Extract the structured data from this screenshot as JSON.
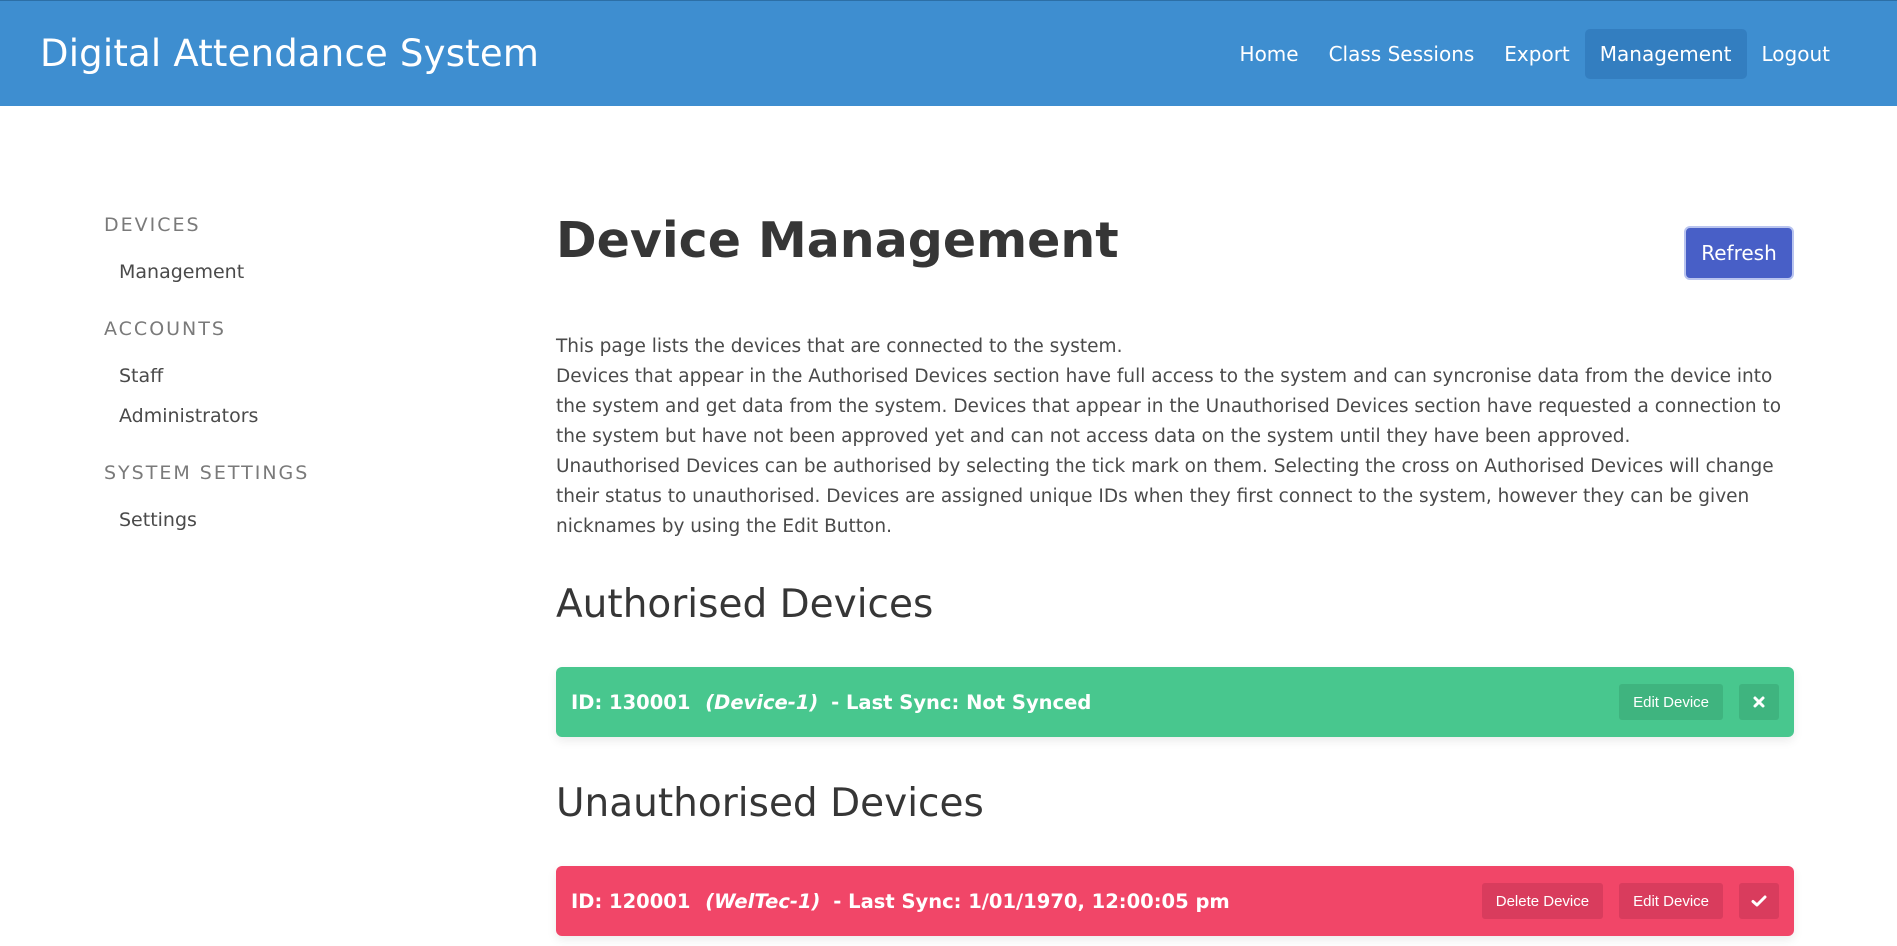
{
  "app": {
    "title": "Digital Attendance System"
  },
  "nav": {
    "items": [
      {
        "label": "Home"
      },
      {
        "label": "Class Sessions"
      },
      {
        "label": "Export"
      },
      {
        "label": "Management",
        "active": true
      },
      {
        "label": "Logout"
      }
    ]
  },
  "sidebar": {
    "sections": [
      {
        "label": "DEVICES",
        "items": [
          {
            "label": "Management"
          }
        ]
      },
      {
        "label": "ACCOUNTS",
        "items": [
          {
            "label": "Staff"
          },
          {
            "label": "Administrators"
          }
        ]
      },
      {
        "label": "SYSTEM SETTINGS",
        "items": [
          {
            "label": "Settings"
          }
        ]
      }
    ]
  },
  "main": {
    "title": "Device Management",
    "refresh_label": "Refresh",
    "description": [
      "This page lists the devices that are connected to the system.",
      "Devices that appear in the Authorised Devices section have full access to the system and can syncronise data from the device into the system and get data from the system. Devices that appear in the Unauthorised Devices section have requested a connection to the system but have not been approved yet and can not access data on the system until they have been approved.",
      "Unauthorised Devices can be authorised by selecting the tick mark on them. Selecting the cross on Authorised Devices will change their status to unauthorised. Devices are assigned unique IDs when they first connect to the system, however they can be given nicknames by using the Edit Button."
    ],
    "authorised": {
      "heading": "Authorised Devices",
      "devices": [
        {
          "id_text": "ID: 130001",
          "nickname": "(Device-1)",
          "sync_text": "- Last Sync: Not Synced",
          "edit_label": "Edit Device",
          "action_icon": "cross-icon",
          "color": "#48c78e"
        }
      ]
    },
    "unauthorised": {
      "heading": "Unauthorised Devices",
      "devices": [
        {
          "id_text": "ID: 120001",
          "nickname": "(WelTec-1)",
          "sync_text": "- Last Sync: 1/01/1970, 12:00:05 pm",
          "delete_label": "Delete Device",
          "edit_label": "Edit Device",
          "action_icon": "check-icon",
          "color": "#f14668"
        }
      ]
    }
  },
  "colors": {
    "navbar": "#3e8ed0",
    "primary_button": "#485fc7",
    "success": "#48c78e",
    "danger": "#f14668"
  }
}
